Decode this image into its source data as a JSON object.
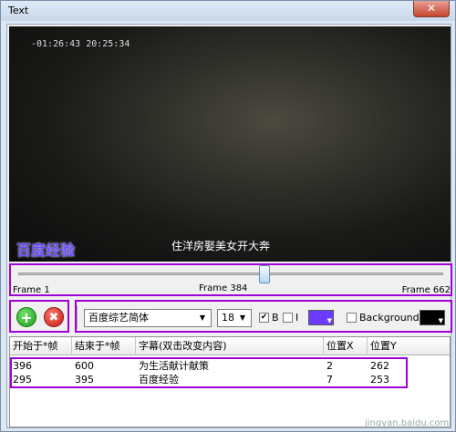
{
  "window": {
    "title": "Text",
    "close_label": "✕"
  },
  "video": {
    "timecode": "-01:26:43  20:25:34",
    "watermark": "百度经验",
    "subtitle": "住洋房娶美女开大奔"
  },
  "slider": {
    "start_label": "Frame 1",
    "current_label": "Frame 384",
    "end_label": "Frame 662",
    "current_frame": 384,
    "total_frames": 662
  },
  "toolbar": {
    "add_icon": "plus-icon",
    "delete_icon": "x-icon",
    "add_glyph": "+",
    "delete_glyph": "✖",
    "font": "百度综艺简体",
    "size": "18",
    "bold_label": "B",
    "bold_checked": true,
    "bold_mark": "✔",
    "italic_label": "I",
    "italic_checked": false,
    "text_color": "#6b3cff",
    "background_label": "Background:",
    "background_checked": false,
    "background_color": "#000000"
  },
  "grid": {
    "columns": [
      "开始于*帧",
      "结束于*帧",
      "字幕(双击改变内容)",
      "位置X",
      "位置Y"
    ],
    "rows": [
      [
        "396",
        "600",
        "为生活献计献策",
        "2",
        "262"
      ],
      [
        "295",
        "395",
        "百度经验",
        "7",
        "253"
      ]
    ]
  },
  "watermark_site": "jingyan.baidu.com"
}
